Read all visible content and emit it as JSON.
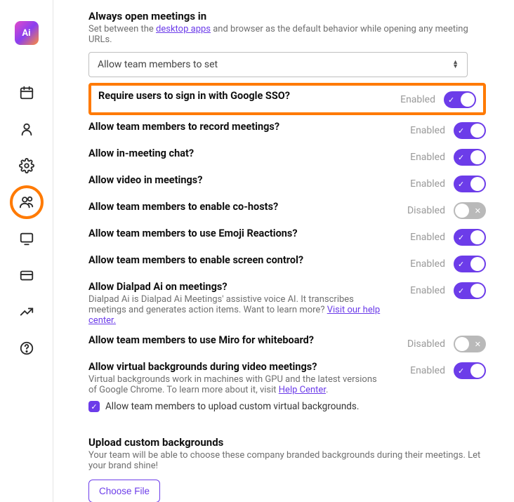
{
  "header": {
    "title": "Always open meetings in",
    "subtitle_pre": "Set between the ",
    "subtitle_link": "desktop apps",
    "subtitle_post": " and browser as the default behavior while opening any meeting URLs.",
    "select_value": "Allow team members to set"
  },
  "settings": [
    {
      "key": "sso",
      "title": "Require users to sign in with Google SSO?",
      "status": "Enabled",
      "on": true,
      "highlight": true
    },
    {
      "key": "record",
      "title": "Allow team members to record meetings?",
      "status": "Enabled",
      "on": true
    },
    {
      "key": "chat",
      "title": "Allow in-meeting chat?",
      "status": "Enabled",
      "on": true
    },
    {
      "key": "video",
      "title": "Allow video in meetings?",
      "status": "Enabled",
      "on": true
    },
    {
      "key": "cohosts",
      "title": "Allow team members to enable co-hosts?",
      "status": "Disabled",
      "on": false
    },
    {
      "key": "emoji",
      "title": "Allow team members to use Emoji Reactions?",
      "status": "Enabled",
      "on": true
    },
    {
      "key": "screencontrol",
      "title": "Allow team members to enable screen control?",
      "status": "Enabled",
      "on": true
    },
    {
      "key": "ai",
      "title": "Allow Dialpad Ai on meetings?",
      "status": "Enabled",
      "on": true,
      "desc_pre": "Dialpad Ai is Dialpad Ai Meetings' assistive voice AI. It transcribes meetings and generates action items. Want to learn more? ",
      "desc_link": "Visit our help center."
    },
    {
      "key": "miro",
      "title": "Allow team members to use Miro for whiteboard?",
      "status": "Disabled",
      "on": false
    },
    {
      "key": "vbg",
      "title": "Allow virtual backgrounds during video meetings?",
      "status": "Enabled",
      "on": true,
      "desc_pre": "Virtual backgrounds work in machines with GPU and the latest versions of Google Chrome. To learn more about it, visit ",
      "desc_link": "Help Center",
      "desc_post": ".",
      "checkbox_label": "Allow team members to upload custom virtual backgrounds.",
      "checkbox_checked": true
    }
  ],
  "upload": {
    "title": "Upload custom backgrounds",
    "desc": "Your team will be able to choose these company branded backgrounds during their meetings. Let your brand shine!",
    "button": "Choose File"
  },
  "logo_text": "Ai"
}
